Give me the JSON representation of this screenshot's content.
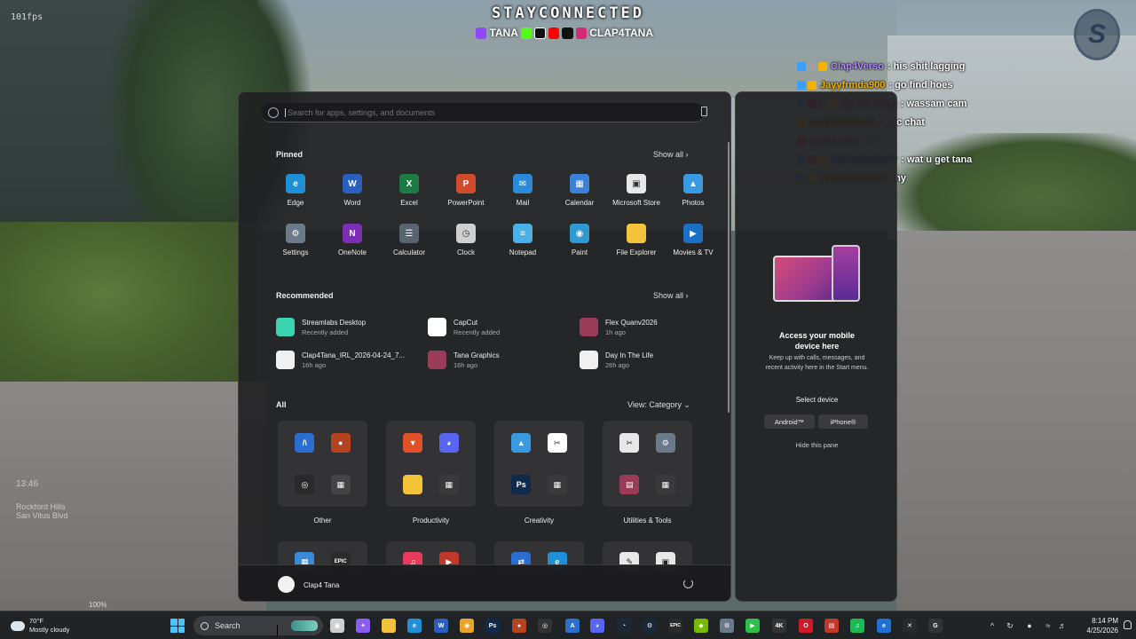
{
  "overlay": {
    "fps": "101fps",
    "stream_title": "STAYCONNECTED",
    "stream_handle_1": "TANA",
    "stream_handle_2": "CLAP4TANA",
    "logo_letter": "S",
    "hud_time": "13:46",
    "hud_location_1": "Rockford Hills",
    "hud_location_2": "San Vitus Blvd",
    "hud_percent": "100%"
  },
  "chat": [
    {
      "user": "Clap4Verso",
      "color": "#b48bff",
      "message": ": his shit lagging",
      "badges": [
        "#3aa0ff",
        "#9aa0a6",
        "#f2b400"
      ]
    },
    {
      "user": "Jayyfrmda900",
      "color": "#f2b400",
      "message": ": go find hoes",
      "badges": [
        "#3aa0ff",
        "#f2b400"
      ]
    },
    {
      "user": "Ty_da_kyng",
      "color": "#ff6fa8",
      "message": ": wassam cam",
      "badges": [
        "#3aa0ff",
        "#e0245e",
        "#9aa0a6",
        "#f2b400"
      ]
    },
    {
      "user": "camfrm5block",
      "color": "#f2b400",
      "message": ": hyc chat",
      "badges": [
        "#f2b400"
      ]
    },
    {
      "user": "munyunVJ",
      "color": "#ff8fa0",
      "message": ": hy",
      "badges": [
        "#d23a3a"
      ]
    },
    {
      "user": "Darealistliferrr",
      "color": "#4aa3ff",
      "message": ": wat u get tana",
      "badges": [
        "#3aa0ff",
        "#d23a3a",
        "#f2b400"
      ]
    },
    {
      "user": "Jayyfrmda900",
      "color": "#f2b400",
      "message": ": hy",
      "badges": [
        "#3aa0ff",
        "#f2b400"
      ]
    }
  ],
  "start_menu": {
    "search_placeholder": "Search for apps, settings, and documents",
    "pinned_title": "Pinned",
    "pinned_show_all": "Show all  ›",
    "pinned": [
      {
        "label": "Edge",
        "icon": "edge-icon",
        "color": "#1f8fd6",
        "glyph": "e"
      },
      {
        "label": "Word",
        "icon": "word-icon",
        "color": "#2b5fbd",
        "glyph": "W"
      },
      {
        "label": "Excel",
        "icon": "excel-icon",
        "color": "#1d7a45",
        "glyph": "X"
      },
      {
        "label": "PowerPoint",
        "icon": "powerpoint-icon",
        "color": "#d04a2b",
        "glyph": "P"
      },
      {
        "label": "Mail",
        "icon": "mail-icon",
        "color": "#2a8ad8",
        "glyph": "✉"
      },
      {
        "label": "Calendar",
        "icon": "calendar-icon",
        "color": "#3b82d6",
        "glyph": "▦"
      },
      {
        "label": "Microsoft Store",
        "icon": "store-icon",
        "color": "#e8e8e8",
        "glyph": "▣"
      },
      {
        "label": "Photos",
        "icon": "photos-icon",
        "color": "#3a9ae0",
        "glyph": "▲"
      },
      {
        "label": "Settings",
        "icon": "settings-icon",
        "color": "#6b7a8a",
        "glyph": "⚙"
      },
      {
        "label": "OneNote",
        "icon": "onenote-icon",
        "color": "#7b2fb5",
        "glyph": "N"
      },
      {
        "label": "Calculator",
        "icon": "calculator-icon",
        "color": "#5a6470",
        "glyph": "☰"
      },
      {
        "label": "Clock",
        "icon": "clock-icon",
        "color": "#cfcfcf",
        "glyph": "◷"
      },
      {
        "label": "Notepad",
        "icon": "notepad-icon",
        "color": "#4ab0e8",
        "glyph": "≡"
      },
      {
        "label": "Paint",
        "icon": "paint-icon",
        "color": "#2f9ad0",
        "glyph": "◉"
      },
      {
        "label": "File Explorer",
        "icon": "folder-icon",
        "color": "#f3c33a",
        "glyph": ""
      },
      {
        "label": "Movies & TV",
        "icon": "movies-icon",
        "color": "#1b6fc4",
        "glyph": "▶"
      }
    ],
    "recommended_title": "Recommended",
    "recommended_show_all": "Show all  ›",
    "recommended": [
      {
        "name": "Streamlabs Desktop",
        "sub": "Recently added",
        "icon": "streamlabs-icon",
        "color": "#3bd4b0"
      },
      {
        "name": "CapCut",
        "sub": "Recently added",
        "icon": "capcut-icon",
        "color": "#ffffff"
      },
      {
        "name": "Flex Quanv2026",
        "sub": "1h ago",
        "icon": "winrar-icon",
        "color": "#9b3b5a"
      },
      {
        "name": "Clap4Tana_IRL_2026-04-24_7...",
        "sub": "16h ago",
        "icon": "video-file-icon",
        "color": "#f0f0f0"
      },
      {
        "name": "Tana Graphics",
        "sub": "16h ago",
        "icon": "winrar-icon",
        "color": "#9b3b5a"
      },
      {
        "name": "Day In The Life",
        "sub": "26h ago",
        "icon": "video-file-icon",
        "color": "#f0f0f0"
      }
    ],
    "all_title": "All",
    "view_label": "View: Category  ⌄",
    "categories": [
      {
        "label": "Other",
        "icons": [
          {
            "n": "arch-icon",
            "c": "#2a6fd0",
            "g": "/\\"
          },
          {
            "n": "brave-like-icon",
            "c": "#b5431f",
            "g": "●"
          },
          {
            "n": "obs-icon",
            "c": "#2a2a2a",
            "g": "◎"
          },
          {
            "n": "folder-group-icon",
            "c": "#444",
            "g": "▦"
          }
        ]
      },
      {
        "label": "Productivity",
        "icons": [
          {
            "n": "brave-icon",
            "c": "#e0512a",
            "g": "▼"
          },
          {
            "n": "discord-icon",
            "c": "#5865f2",
            "g": "◕"
          },
          {
            "n": "file-explorer-icon",
            "c": "#f3c33a",
            "g": ""
          },
          {
            "n": "apps-group-icon",
            "c": "#3a3a3a",
            "g": "▦"
          }
        ]
      },
      {
        "label": "Creativity",
        "icons": [
          {
            "n": "photos-icon",
            "c": "#3a9ae0",
            "g": "▲"
          },
          {
            "n": "capcut-icon",
            "c": "#ffffff",
            "g": "✂"
          },
          {
            "n": "photoshop-icon",
            "c": "#0f2a4a",
            "g": "Ps"
          },
          {
            "n": "creative-group-icon",
            "c": "#3a3a3a",
            "g": "▦"
          }
        ]
      },
      {
        "label": "Utilities & Tools",
        "icons": [
          {
            "n": "snipping-icon",
            "c": "#e8e8e8",
            "g": "✂"
          },
          {
            "n": "settings-icon",
            "c": "#6b7a8a",
            "g": "⚙"
          },
          {
            "n": "winrar-icon",
            "c": "#9b3b5a",
            "g": "▤"
          },
          {
            "n": "tools-group-icon",
            "c": "#3a3a3a",
            "g": "▦"
          }
        ]
      }
    ],
    "categories_row2": [
      {
        "icons": [
          {
            "n": "windows-icon",
            "c": "#3a8ad8",
            "g": "▦"
          },
          {
            "n": "epic-icon",
            "c": "#2a2a2a",
            "g": "EPIC"
          }
        ]
      },
      {
        "icons": [
          {
            "n": "music-icon",
            "c": "#e83a5a",
            "g": "♫"
          },
          {
            "n": "media-player-icon",
            "c": "#c0392b",
            "g": "▶"
          }
        ]
      },
      {
        "icons": [
          {
            "n": "quick-assist-icon",
            "c": "#2a6fd0",
            "g": "⇄"
          },
          {
            "n": "edge-dev-icon",
            "c": "#1f8fd6",
            "g": "e"
          }
        ]
      },
      {
        "icons": [
          {
            "n": "paint-tool-icon",
            "c": "#e8e8e8",
            "g": "✎"
          },
          {
            "n": "utility-icon",
            "c": "#e8e8e8",
            "g": "▣"
          }
        ]
      }
    ],
    "user_name": "Clap4 Tana"
  },
  "side_pane": {
    "title": "Access your mobile device here",
    "text": "Keep up with calls, messages, and recent activity here in the Start menu.",
    "select_device": "Select device",
    "android": "Android™",
    "iphone": "iPhone®",
    "hide": "Hide this pane"
  },
  "taskbar": {
    "temp": "70°F",
    "weather": "Mostly cloudy",
    "search_label": "Search",
    "time": "8:14 PM",
    "date": "4/25/2026",
    "apps": [
      {
        "n": "task-view-icon",
        "c": "#cfcfcf",
        "g": "▣"
      },
      {
        "n": "copilot-icon",
        "c": "#8a5cf0",
        "g": "✦"
      },
      {
        "n": "file-explorer-icon",
        "c": "#f3c33a",
        "g": ""
      },
      {
        "n": "edge-icon",
        "c": "#1f8fd6",
        "g": "e"
      },
      {
        "n": "word-like-icon",
        "c": "#2b5fbd",
        "g": "W"
      },
      {
        "n": "chrome-icon",
        "c": "#e8a52a",
        "g": "◉"
      },
      {
        "n": "photoshop-icon",
        "c": "#0f2a4a",
        "g": "Ps"
      },
      {
        "n": "brave-icon",
        "c": "#b5431f",
        "g": "●"
      },
      {
        "n": "obs-icon",
        "c": "#333",
        "g": "◎"
      },
      {
        "n": "arch-icon",
        "c": "#2a6fd0",
        "g": "A"
      },
      {
        "n": "discord-icon",
        "c": "#5865f2",
        "g": "◕"
      },
      {
        "n": "steam-like-icon",
        "c": "#1b2838",
        "g": "◔"
      },
      {
        "n": "steam-icon",
        "c": "#1b2838",
        "g": "⚙"
      },
      {
        "n": "epic-icon",
        "c": "#2a2a2a",
        "g": "EPIC"
      },
      {
        "n": "nvidia-icon",
        "c": "#76b900",
        "g": "◆"
      },
      {
        "n": "settings-icon",
        "c": "#6b7a8a",
        "g": "⚙"
      },
      {
        "n": "play-icon",
        "c": "#2fbf4a",
        "g": "▶"
      },
      {
        "n": "4k-icon",
        "c": "#333",
        "g": "4K"
      },
      {
        "n": "opera-icon",
        "c": "#d01a2a",
        "g": "O"
      },
      {
        "n": "voice-icon",
        "c": "#c0392b",
        "g": "▤"
      },
      {
        "n": "spotify-icon",
        "c": "#1db954",
        "g": "♫"
      },
      {
        "n": "edge-beta-icon",
        "c": "#1f6fd6",
        "g": "e"
      },
      {
        "n": "xbox-icon",
        "c": "#2a2a2a",
        "g": "✕"
      },
      {
        "n": "gog-icon",
        "c": "#333",
        "g": "G"
      }
    ]
  }
}
